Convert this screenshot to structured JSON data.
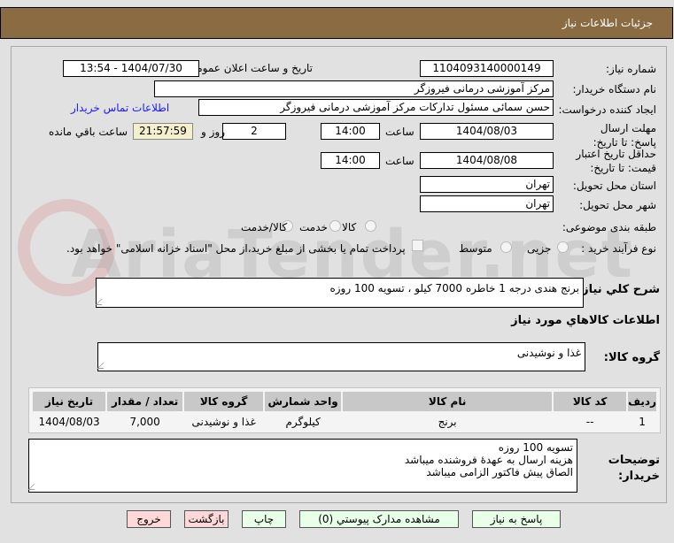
{
  "header": {
    "title": "جزئیات اطلاعات نیاز"
  },
  "watermark": "AriaTender.net",
  "form": {
    "need_number_label": "شماره نیاز:",
    "need_number": "1104093140000149",
    "announce_label": "تاریخ و ساعت اعلان عمومی:",
    "announce_value": "1404/07/30 - 13:54",
    "buyer_org_label": "نام دستگاه خریدار:",
    "buyer_org": "مرکز آموزشی درمانی فیروزگر",
    "creator_label": "ایجاد کننده درخواست:",
    "creator": "حسن سمائی مسئول تدارکات مرکز آموزشی درمانی فیروزگر",
    "contact_link": "اطلاعات تماس خریدار",
    "reply_deadline_label": "مهلت ارسال پاسخ: تا تاریخ:",
    "reply_date": "1404/08/03",
    "time_label": "ساعت",
    "reply_time": "14:00",
    "days": "2",
    "days_label": "روز و",
    "remaining": "21:57:59",
    "remaining_label": "ساعت باقي مانده",
    "validity_label": "حداقل تاریخ اعتبار قیمت: تا تاریخ:",
    "validity_date": "1404/08/08",
    "validity_time": "14:00",
    "province_label": "استان محل تحویل:",
    "province": "تهران",
    "city_label": "شهر محل تحویل:",
    "city": "تهران",
    "category_label": "طبقه بندی موضوعی:",
    "category_options": [
      "کالا",
      "خدمت",
      "کالا/خدمت"
    ],
    "process_label": "نوع فرآیند خرید :",
    "process_options": [
      "جزیی",
      "متوسط"
    ],
    "payment_note": "پرداخت تمام یا بخشی از مبلغ خرید،از محل \"اسناد خزانه اسلامی\" خواهد بود.",
    "description_label": "شرح کلي نياز:",
    "description": "برنج هندی درجه 1 خاطره 7000 کیلو ، تسویه 100 روزه",
    "goods_info_title": "اطلاعات کالاهاي مورد نياز",
    "goods_group_label": "گروه کالا:",
    "goods_group": "غذا و نوشیدنی"
  },
  "table": {
    "headers": [
      "رديف",
      "کد کالا",
      "نام کالا",
      "واحد شمارش",
      "گروه کالا",
      "تعداد / مقدار",
      "تاریخ نیاز"
    ],
    "rows": [
      [
        "1",
        "--",
        "برنج",
        "کیلوگرم",
        "غذا و نوشیدنی",
        "7,000",
        "1404/08/03"
      ]
    ]
  },
  "notes": {
    "label": "توضيحات خريدار:",
    "lines": [
      "تسویه 100 روزه",
      "هزینه ارسال به عهدهٔ فروشنده میباشد",
      "الصاق پیش فاکتور الزامی میباشد"
    ]
  },
  "buttons": {
    "reply": "پاسخ به نياز",
    "attachments": "مشاهده مدارک پيوستي (0)",
    "print": "چاپ",
    "back": "بازگشت",
    "exit": "خروج"
  }
}
